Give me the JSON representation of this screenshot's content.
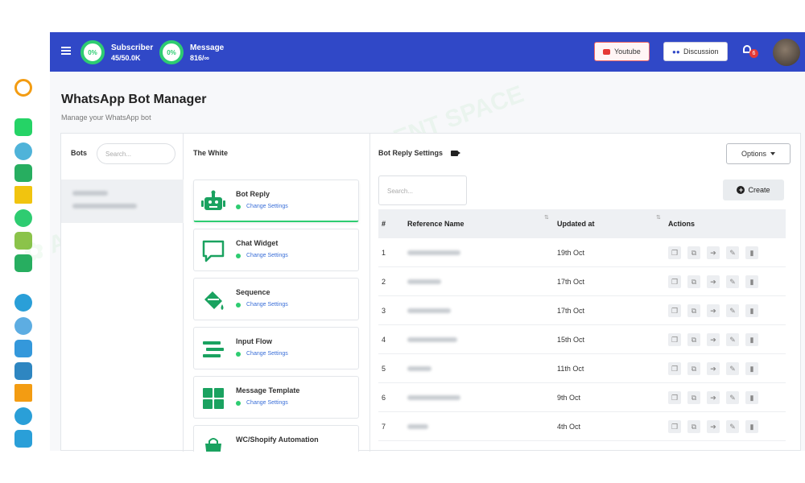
{
  "topbar": {
    "subscriber": {
      "label": "Subscriber",
      "value": "45/50.0K",
      "percent": "0%"
    },
    "message": {
      "label": "Message",
      "value": "816/∞",
      "percent": "0%"
    },
    "youtube_label": "Youtube",
    "discussion_label": "Discussion",
    "notification_count": "6"
  },
  "page": {
    "title": "WhatsApp Bot Manager",
    "subtitle": "Manage your WhatsApp bot"
  },
  "bots_panel": {
    "label": "Bots",
    "search_placeholder": "Search..."
  },
  "bot_menu": {
    "header": "The White",
    "items": [
      {
        "name": "Bot Reply",
        "link": "Change Settings",
        "icon": "robot-icon"
      },
      {
        "name": "Chat Widget",
        "link": "Change Settings",
        "icon": "chat-bubble-icon"
      },
      {
        "name": "Sequence",
        "link": "Change Settings",
        "icon": "paint-bucket-icon"
      },
      {
        "name": "Input Flow",
        "link": "Change Settings",
        "icon": "flow-lines-icon"
      },
      {
        "name": "Message Template",
        "link": "Change Settings",
        "icon": "grid-icon"
      },
      {
        "name": "WC/Shopify Automation",
        "link": "",
        "icon": "shopping-bag-icon"
      }
    ]
  },
  "reply_panel": {
    "header": "Bot Reply Settings",
    "options_label": "Options",
    "search_placeholder": "Search...",
    "create_label": "Create",
    "columns": {
      "num": "#",
      "ref": "Reference Name",
      "updated": "Updated at",
      "actions": "Actions"
    },
    "rows": [
      {
        "num": "1",
        "updated": "19th Oct"
      },
      {
        "num": "2",
        "updated": "17th Oct"
      },
      {
        "num": "3",
        "updated": "17th Oct"
      },
      {
        "num": "4",
        "updated": "15th Oct"
      },
      {
        "num": "5",
        "updated": "11th Oct"
      },
      {
        "num": "6",
        "updated": "9th Oct"
      },
      {
        "num": "7",
        "updated": "4th Oct"
      }
    ]
  },
  "colors": {
    "topbar": "#3048c7",
    "accent_green": "#2ecc71",
    "link_blue": "#3a6fd8"
  }
}
